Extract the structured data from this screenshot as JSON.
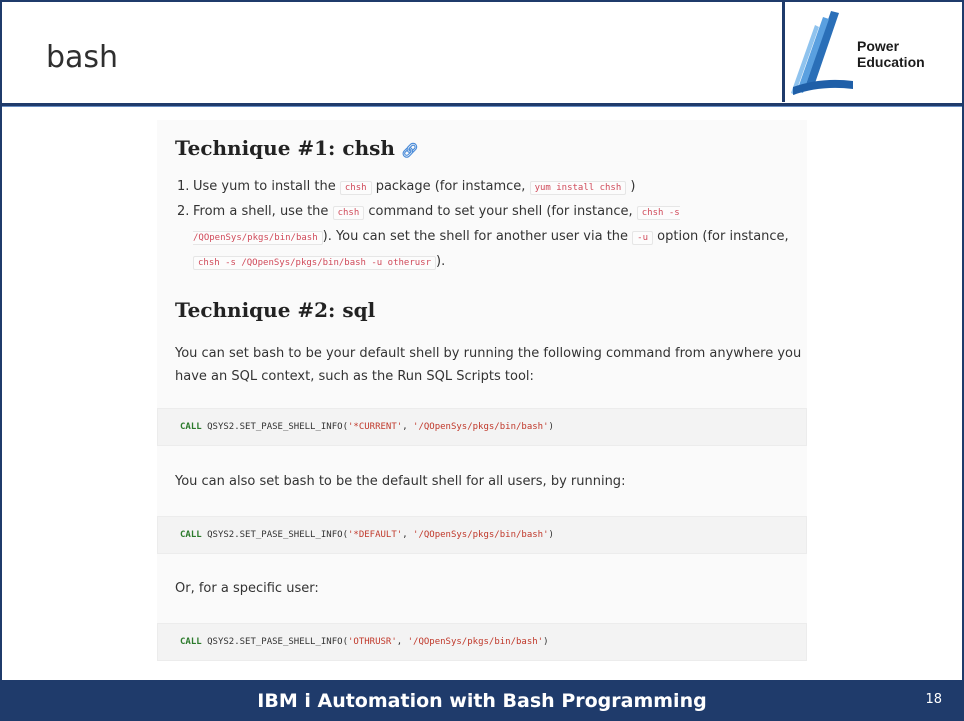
{
  "slide": {
    "title": "bash",
    "logo": {
      "line1": "Power",
      "line2": "Education"
    },
    "footer_title": "IBM i Automation with Bash Programming",
    "page_number": "18"
  },
  "content": {
    "technique1": {
      "heading": "Technique #1: chsh",
      "link_icon": "link-icon",
      "item1": {
        "num": "1.",
        "t1": "Use yum to install the",
        "c1": "chsh",
        "t2": "package (for instamce,",
        "c2": "yum install chsh",
        "t3": ")"
      },
      "item2": {
        "num": "2.",
        "t1": "From a shell, use the",
        "c1": "chsh",
        "t2": "command to set your shell (for instance,",
        "c2": "chsh -s /QOpenSys/pkgs/bin/bash",
        "t3": "). You can set the shell for another user via the",
        "c3": "-u",
        "t4": "option (for instance,",
        "c4": "chsh -s /QOpenSys/pkgs/bin/bash -u otherusr",
        "t5": ")."
      }
    },
    "technique2": {
      "heading": "Technique #2: sql",
      "para1": "You can set bash to be your default shell by running the following command from anywhere you have an SQL context, such as the Run SQL Scripts tool:",
      "code1": {
        "kw": "CALL",
        "fn": " QSYS2.SET_PASE_SHELL_INFO(",
        "arg1": "'*CURRENT'",
        "sep": ", ",
        "arg2": "'/QOpenSys/pkgs/bin/bash'",
        "end": ")"
      },
      "para2": "You can also set bash to be the default shell for all users, by running:",
      "code2": {
        "kw": "CALL",
        "fn": " QSYS2.SET_PASE_SHELL_INFO(",
        "arg1": "'*DEFAULT'",
        "sep": ", ",
        "arg2": "'/QOpenSys/pkgs/bin/bash'",
        "end": ")"
      },
      "para3": "Or, for a specific user:",
      "code3": {
        "kw": "CALL",
        "fn": " QSYS2.SET_PASE_SHELL_INFO(",
        "arg1": "'OTHRUSR'",
        "sep": ", ",
        "arg2": "'/QOpenSys/pkgs/bin/bash'",
        "end": ")"
      }
    }
  },
  "colors": {
    "frame": "#1f3b6b",
    "code_text": "#d04a5a",
    "keyword": "#2b7a2b",
    "string": "#c0392b"
  }
}
